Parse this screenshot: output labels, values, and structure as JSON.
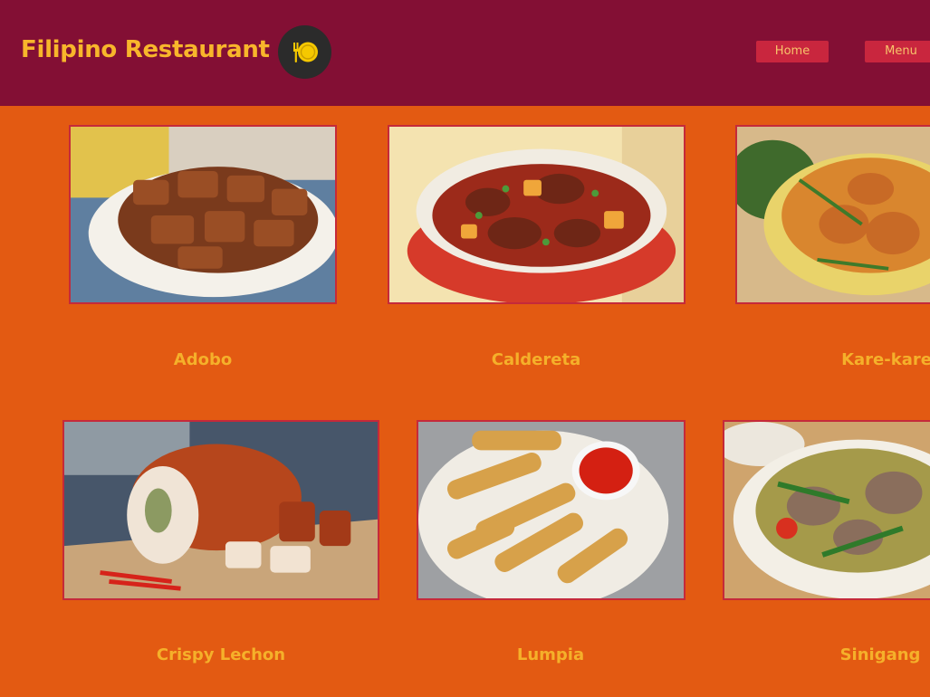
{
  "header": {
    "title": "Filipino Restaurant",
    "logo_icon": "plate-fork-icon",
    "nav": [
      {
        "label": "Home"
      },
      {
        "label": "Menu"
      }
    ]
  },
  "dishes": [
    {
      "name": "Adobo"
    },
    {
      "name": "Caldereta"
    },
    {
      "name": "Kare-kare"
    },
    {
      "name": "Crispy Lechon"
    },
    {
      "name": "Lumpia"
    },
    {
      "name": "Sinigang"
    }
  ],
  "colors": {
    "header_bg": "#830f34",
    "page_bg": "#e35a12",
    "title": "#f8b62b",
    "nav_button": "#c9263e",
    "card_border": "#c52a3a"
  }
}
